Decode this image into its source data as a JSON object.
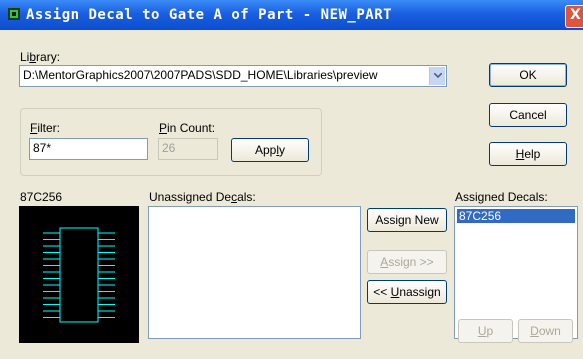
{
  "window": {
    "title": "Assign Decal to Gate A of Part - NEW_PART",
    "close_label": "X"
  },
  "library": {
    "label_pre": "Li",
    "label_key": "b",
    "label_post": "rary:",
    "value": "D:\\MentorGraphics2007\\2007PADS\\SDD_HOME\\Libraries\\preview"
  },
  "buttons": {
    "ok": "OK",
    "cancel": "Cancel",
    "help_key": "H",
    "help_rest": "elp",
    "apply_pre": "App",
    "apply_key": "l",
    "apply_post": "y",
    "assign_new": "Assign New",
    "assign_key": "A",
    "assign_rest": "ssign >>",
    "unassign_pre": "<< ",
    "unassign_key": "U",
    "unassign_post": "nassign",
    "up_key": "U",
    "up_rest": "p",
    "down_key": "D",
    "down_rest": "own"
  },
  "filter": {
    "label_key": "F",
    "label_rest": "ilter:",
    "value": "87*"
  },
  "pin_count": {
    "label_key": "P",
    "label_rest": "in Count:",
    "value": "26"
  },
  "preview": {
    "label": "87C256"
  },
  "unassigned": {
    "label_pre": "Unassigned De",
    "label_key": "c",
    "label_post": "als:",
    "items": []
  },
  "assigned": {
    "label": "Assigned Decals:",
    "items": [
      "87C256"
    ]
  },
  "colors": {
    "title_bar": "#0b4fd0",
    "dialog_bg": "#ece9d8",
    "selection": "#316ac5",
    "decal_outline": "#00ffff"
  }
}
